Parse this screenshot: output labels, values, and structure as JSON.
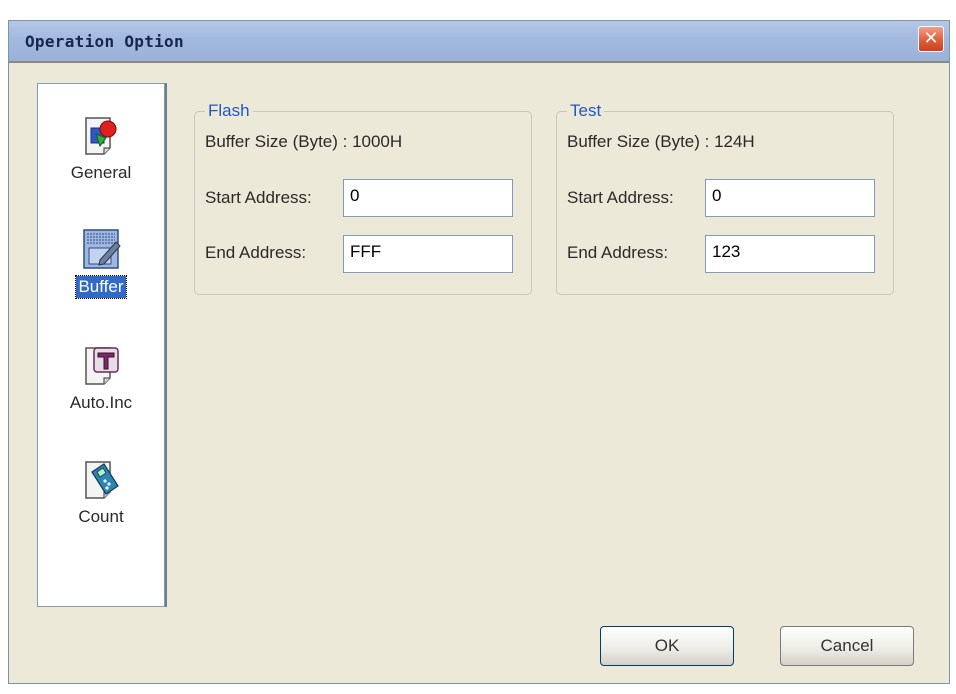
{
  "window": {
    "title": "Operation Option"
  },
  "sidebar": {
    "items": [
      {
        "label": "General",
        "icon": "general-icon"
      },
      {
        "label": "Buffer",
        "icon": "buffer-icon",
        "selected": true
      },
      {
        "label": "Auto.Inc",
        "icon": "auto-inc-icon"
      },
      {
        "label": "Count",
        "icon": "count-icon"
      }
    ]
  },
  "flash": {
    "legend": "Flash",
    "buffer_size": "Buffer Size (Byte) :  1000H",
    "start_label": "Start Address:",
    "start_value": "0",
    "end_label": "End Address:",
    "end_value": "FFF"
  },
  "test": {
    "legend": "Test",
    "buffer_size": "Buffer Size (Byte) :  124H",
    "start_label": "Start Address:",
    "start_value": "0",
    "end_label": "End Address:",
    "end_value": "123"
  },
  "buttons": {
    "ok": "OK",
    "cancel": "Cancel"
  },
  "colors": {
    "selection": "#316ac5",
    "legend": "#2257c5",
    "close": "#e35c38"
  }
}
